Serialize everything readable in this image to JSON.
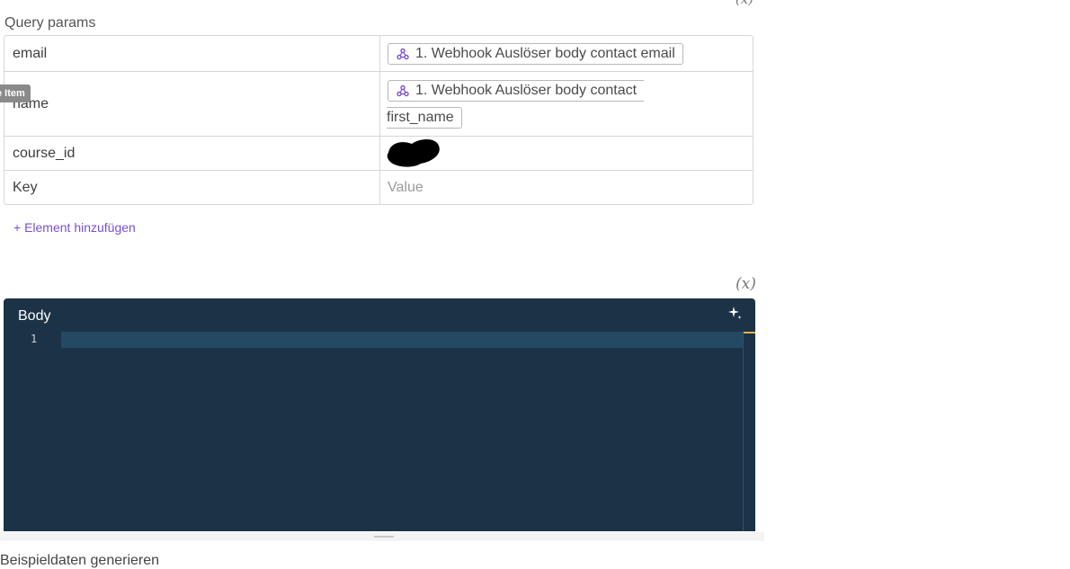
{
  "top_variable_label": "(x)",
  "query_params": {
    "label": "Query params",
    "rows": [
      {
        "key": "email",
        "value_pill": "1. Webhook Auslöser body contact email"
      },
      {
        "key": "name",
        "value_pill_line1": "1. Webhook Auslöser body contact",
        "value_pill_line2": "first_name"
      },
      {
        "key": "course_id",
        "value": ""
      },
      {
        "key_placeholder": "Key",
        "value_placeholder": "Value"
      }
    ],
    "tooltip": "e Item",
    "add_item": "+ Element hinzufügen"
  },
  "body_editor": {
    "variable_label": "(x)",
    "title": "Body",
    "line_numbers": [
      "1"
    ]
  },
  "bottom_text": "Beispieldaten generieren",
  "colors": {
    "accent": "#7a4fd6",
    "editor_bg": "#1c3347",
    "line_highlight": "#244a63"
  }
}
